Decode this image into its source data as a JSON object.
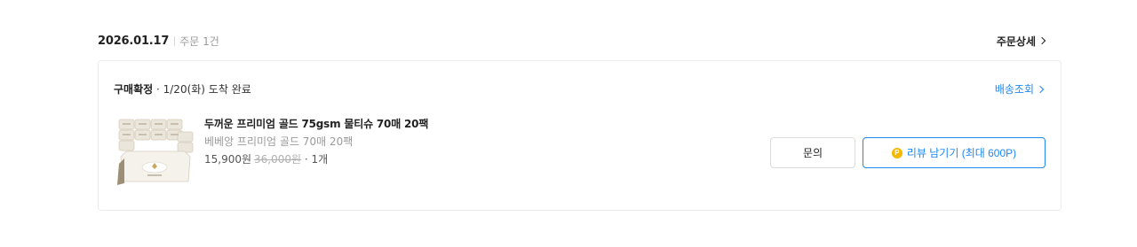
{
  "order": {
    "date": "2026.01.17",
    "count_label": "주문 1건",
    "detail_label": "주문상세"
  },
  "card": {
    "status_strong": "구매확정",
    "status_detail": "· 1/20(화) 도착 완료",
    "tracking_label": "배송조회",
    "product": {
      "name": "두꺼운 프리미엄 골드 75gsm 물티슈 70매 20팩",
      "option": "베베앙 프리미엄 골드 70매 20팩",
      "price": "15,900원",
      "original_price": "36,000원",
      "quantity": "· 1개",
      "icon": "wet-wipes-product-image"
    },
    "inquiry_label": "문의",
    "review_label": "리뷰 남기기 (최대 600P)",
    "point_icon_text": "P"
  },
  "colors": {
    "accent": "#1e88f5",
    "point": "#f5b800"
  }
}
